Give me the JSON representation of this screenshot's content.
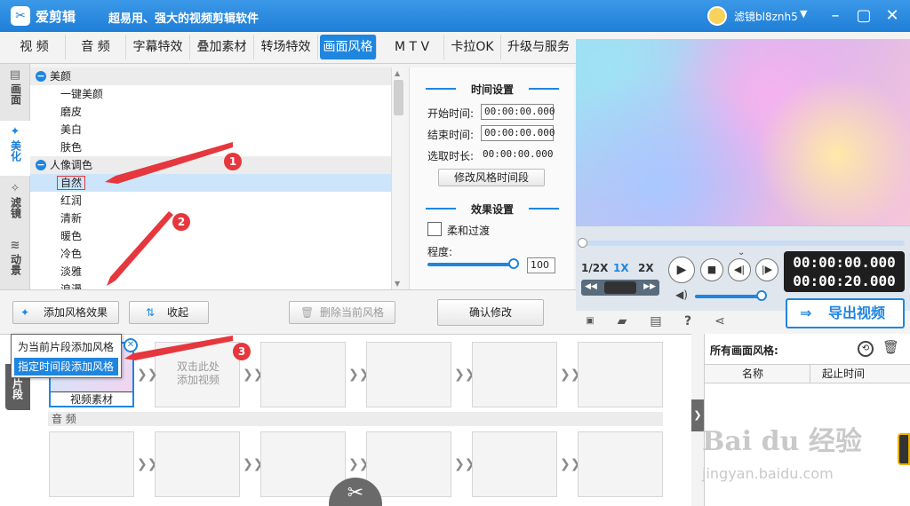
{
  "app": {
    "name": "爱剪辑",
    "slogan": "超易用、强大的视频剪辑软件",
    "username": "滤镜bl8znh5"
  },
  "tabs": [
    "视 频",
    "音 频",
    "字幕特效",
    "叠加素材",
    "转场特效",
    "画面风格",
    "M T V",
    "卡拉OK",
    "升级与服务"
  ],
  "sidetabs": [
    "画面",
    "美化",
    "滤镜",
    "动景"
  ],
  "stylelist": {
    "group1": "美颜",
    "group1_items": [
      "一键美颜",
      "磨皮",
      "美白",
      "肤色"
    ],
    "group2": "人像调色",
    "group2_items": [
      "自然",
      "红润",
      "清新",
      "暖色",
      "冷色",
      "淡雅",
      "浪漫"
    ]
  },
  "settings": {
    "time_title": "时间设置",
    "start_label": "开始时间:",
    "start_value": "00:00:00.000",
    "end_label": "结束时间:",
    "end_value": "00:00:00.000",
    "duration_label": "选取时长:",
    "duration_value": "00:00:00.000",
    "modify_time_button": "修改风格时间段",
    "effect_title": "效果设置",
    "soft_transition": "柔和过渡",
    "degree_label": "程度:",
    "degree_value": "100",
    "degree_fraction": 1.0
  },
  "actions": {
    "add_effect": "添加风格效果",
    "collapse": "收起",
    "delete_style": "删除当前风格",
    "confirm": "确认修改"
  },
  "popup": {
    "opt1": "为当前片段添加风格",
    "opt2": "指定时间段添加风格"
  },
  "player": {
    "speeds": [
      "1/2X",
      "1X",
      "2X"
    ],
    "time_current": "00:00:00.000",
    "time_total": "00:00:20.000",
    "export": "导出视频"
  },
  "timeline": {
    "sidebar_label": "片段",
    "clip_label": "视频素材",
    "placeholder": "双击此处\n添加视频",
    "audio_label": "音 频"
  },
  "right_panel": {
    "title": "所有画面风格:",
    "col_name": "名称",
    "col_time": "起止时间"
  },
  "watermark": {
    "main": "Bai du 经验",
    "sub": "jingyan.baidu.com"
  },
  "annotations": [
    "1",
    "2",
    "3"
  ],
  "colors": {
    "accent": "#1f86e0",
    "annotation": "#e5373d"
  }
}
